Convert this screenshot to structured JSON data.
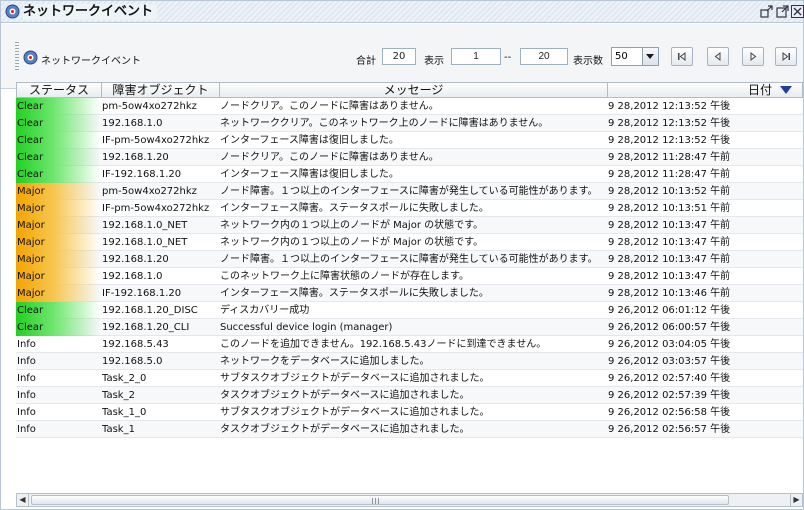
{
  "window": {
    "title": "ネットワークイベント",
    "icons": {
      "app": "network-event-icon",
      "undock": "undock-icon",
      "detach": "detach-icon",
      "close": "close-icon"
    }
  },
  "toolbar": {
    "view_label": "ネットワークイベント",
    "view_icon": "network-event-icon",
    "total_label": "合計",
    "total_value": "20",
    "display_label": "表示",
    "range_from": "1",
    "range_sep": "--",
    "range_to": "20",
    "page_size_label": "表示数",
    "page_size_value": "50",
    "nav_icons": [
      "first-page-icon",
      "previous-page-icon",
      "next-page-icon",
      "last-page-icon"
    ]
  },
  "table": {
    "columns": [
      "ステータス",
      "障害オブジェクト",
      "メッセージ",
      "日付"
    ],
    "sort_icon": "sort-descending-icon",
    "rows": [
      {
        "status": "Clear",
        "severity": "clear",
        "object": "pm-5ow4xo272hkz",
        "message": "ノードクリア。このノードに障害はありません。",
        "date": "9 28,2012 12:13:52 午後"
      },
      {
        "status": "Clear",
        "severity": "clear",
        "object": "192.168.1.0",
        "message": "ネットワーククリア。このネットワーク上のノードに障害はありません。",
        "date": "9 28,2012 12:13:52 午後"
      },
      {
        "status": "Clear",
        "severity": "clear",
        "object": "IF-pm-5ow4xo272hkz",
        "message": "インターフェース障害は復旧しました。",
        "date": "9 28,2012 12:13:52 午後"
      },
      {
        "status": "Clear",
        "severity": "clear",
        "object": "192.168.1.20",
        "message": "ノードクリア。このノードに障害はありません。",
        "date": "9 28,2012 11:28:47 午前"
      },
      {
        "status": "Clear",
        "severity": "clear",
        "object": "IF-192.168.1.20",
        "message": "インターフェース障害は復旧しました。",
        "date": "9 28,2012 11:28:47 午前"
      },
      {
        "status": "Major",
        "severity": "major",
        "object": "pm-5ow4xo272hkz",
        "message": "ノード障害。１つ以上のインターフェースに障害が発生している可能性があります。",
        "date": "9 28,2012 10:13:52 午前"
      },
      {
        "status": "Major",
        "severity": "major",
        "object": "IF-pm-5ow4xo272hkz",
        "message": "インターフェース障害。ステータスポールに失敗しました。",
        "date": "9 28,2012 10:13:51 午前"
      },
      {
        "status": "Major",
        "severity": "major",
        "object": "192.168.1.0_NET",
        "message": "ネットワーク内の１つ以上のノードが Major の状態です。",
        "date": "9 28,2012 10:13:47 午前"
      },
      {
        "status": "Major",
        "severity": "major",
        "object": "192.168.1.0_NET",
        "message": "ネットワーク内の１つ以上のノードが Major の状態です。",
        "date": "9 28,2012 10:13:47 午前"
      },
      {
        "status": "Major",
        "severity": "major",
        "object": "192.168.1.20",
        "message": "ノード障害。１つ以上のインターフェースに障害が発生している可能性があります。",
        "date": "9 28,2012 10:13:47 午前"
      },
      {
        "status": "Major",
        "severity": "major",
        "object": "192.168.1.0",
        "message": "このネットワーク上に障害状態のノードが存在します。",
        "date": "9 28,2012 10:13:47 午前"
      },
      {
        "status": "Major",
        "severity": "major",
        "object": "IF-192.168.1.20",
        "message": "インターフェース障害。ステータスポールに失敗しました。",
        "date": "9 28,2012 10:13:46 午前"
      },
      {
        "status": "Clear",
        "severity": "clear",
        "object": "192.168.1.20_DISC",
        "message": "ディスカバリー成功",
        "date": "9 26,2012 06:01:12 午後"
      },
      {
        "status": "Clear",
        "severity": "clear",
        "object": "192.168.1.20_CLI",
        "message": "Successful device login (manager)",
        "date": "9 26,2012 06:00:57 午後"
      },
      {
        "status": "Info",
        "severity": "info",
        "object": "192.168.5.43",
        "message": "このノードを追加できません。192.168.5.43ノードに到達できません。",
        "date": "9 26,2012 03:04:05 午後"
      },
      {
        "status": "Info",
        "severity": "info",
        "object": "192.168.5.0",
        "message": "ネットワークをデータベースに追加しました。",
        "date": "9 26,2012 03:03:57 午後"
      },
      {
        "status": "Info",
        "severity": "info",
        "object": "Task_2_0",
        "message": "サブタスクオブジェクトがデータベースに追加されました。",
        "date": "9 26,2012 02:57:40 午後"
      },
      {
        "status": "Info",
        "severity": "info",
        "object": "Task_2",
        "message": "タスクオブジェクトがデータベースに追加されました。",
        "date": "9 26,2012 02:57:39 午後"
      },
      {
        "status": "Info",
        "severity": "info",
        "object": "Task_1_0",
        "message": "サブタスクオブジェクトがデータベースに追加されました。",
        "date": "9 26,2012 02:56:58 午後"
      },
      {
        "status": "Info",
        "severity": "info",
        "object": "Task_1",
        "message": "タスクオブジェクトがデータベースに追加されました。",
        "date": "9 26,2012 02:56:57 午後"
      }
    ]
  },
  "colors": {
    "clear": "#22d022",
    "major": "#f4a400",
    "accent": "#1f3f9f"
  }
}
